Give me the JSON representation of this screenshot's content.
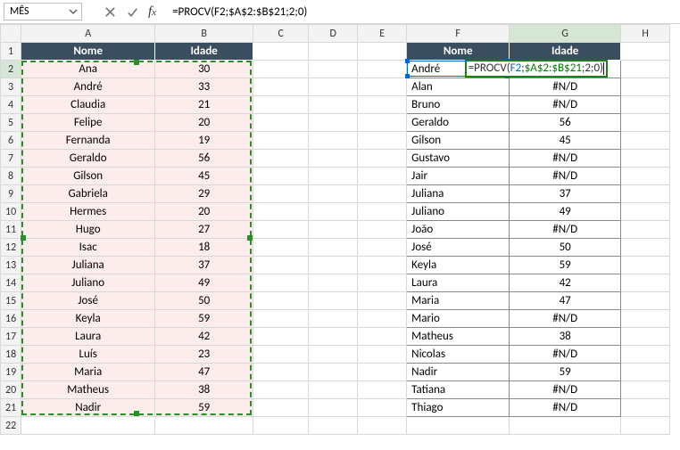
{
  "namebox": {
    "value": "MÊS"
  },
  "formula_bar": {
    "text": "=PROCV(F2;$A$2:$B$21;2;0)"
  },
  "columns": [
    "A",
    "B",
    "C",
    "D",
    "E",
    "F",
    "G",
    "H"
  ],
  "left_table": {
    "headers": {
      "A": "Nome",
      "B": "Idade"
    },
    "rows": [
      {
        "n": "Ana",
        "i": "30"
      },
      {
        "n": "André",
        "i": "33"
      },
      {
        "n": "Claudia",
        "i": "21"
      },
      {
        "n": "Felipe",
        "i": "20"
      },
      {
        "n": "Fernanda",
        "i": "19"
      },
      {
        "n": "Geraldo",
        "i": "56"
      },
      {
        "n": "Gilson",
        "i": "45"
      },
      {
        "n": "Gabriela",
        "i": "29"
      },
      {
        "n": "Hermes",
        "i": "20"
      },
      {
        "n": "Hugo",
        "i": "27"
      },
      {
        "n": "Isac",
        "i": "18"
      },
      {
        "n": "Juliana",
        "i": "37"
      },
      {
        "n": "Juliano",
        "i": "49"
      },
      {
        "n": "José",
        "i": "50"
      },
      {
        "n": "Keyla",
        "i": "59"
      },
      {
        "n": "Laura",
        "i": "42"
      },
      {
        "n": "Luís",
        "i": "23"
      },
      {
        "n": "Maria",
        "i": "47"
      },
      {
        "n": "Matheus",
        "i": "38"
      },
      {
        "n": "Nadir",
        "i": "59"
      }
    ]
  },
  "right_table": {
    "headers": {
      "F": "Nome",
      "G": "Idade"
    },
    "rows": [
      {
        "n": "André",
        "i": "=PROCV(F2;$A$2:$B$21;2;0)"
      },
      {
        "n": "Alan",
        "i": "#N/D"
      },
      {
        "n": "Bruno",
        "i": "#N/D"
      },
      {
        "n": "Geraldo",
        "i": "56"
      },
      {
        "n": "Gilson",
        "i": "45"
      },
      {
        "n": "Gustavo",
        "i": "#N/D"
      },
      {
        "n": "Jair",
        "i": "#N/D"
      },
      {
        "n": "Juliana",
        "i": "37"
      },
      {
        "n": "Juliano",
        "i": "49"
      },
      {
        "n": "João",
        "i": "#N/D"
      },
      {
        "n": "José",
        "i": "50"
      },
      {
        "n": "Keyla",
        "i": "59"
      },
      {
        "n": "Laura",
        "i": "42"
      },
      {
        "n": "Maria",
        "i": "47"
      },
      {
        "n": "Mario",
        "i": "#N/D"
      },
      {
        "n": "Matheus",
        "i": "38"
      },
      {
        "n": "Nicolas",
        "i": "#N/D"
      },
      {
        "n": "Nadir",
        "i": "59"
      },
      {
        "n": "Tatiana",
        "i": "#N/D"
      },
      {
        "n": "Thiago",
        "i": "#N/D"
      }
    ]
  },
  "edit_cell": {
    "prefix": "=PROCV(",
    "arg1": "F2",
    "sep1": ";",
    "arg2": "$A$2:$B$21",
    "rest": ";2;0)"
  },
  "row_count": 22
}
